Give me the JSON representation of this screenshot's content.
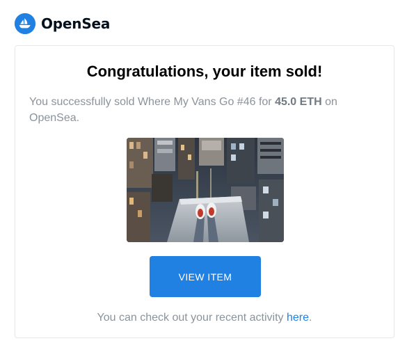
{
  "brand": {
    "name": "OpenSea",
    "logo_icon": "sailboat-icon",
    "accent_color": "#2081e2"
  },
  "email": {
    "headline": "Congratulations, your item sold!",
    "message_prefix": "You successfully sold Where My Vans Go #46 for ",
    "price": "45.0 ETH",
    "message_suffix": " on OpenSea.",
    "item_image": "rooftop-city-photo",
    "view_button_label": "VIEW ITEM",
    "footer_text": "You can check out your recent activity ",
    "footer_link_label": "here",
    "footer_end": "."
  }
}
